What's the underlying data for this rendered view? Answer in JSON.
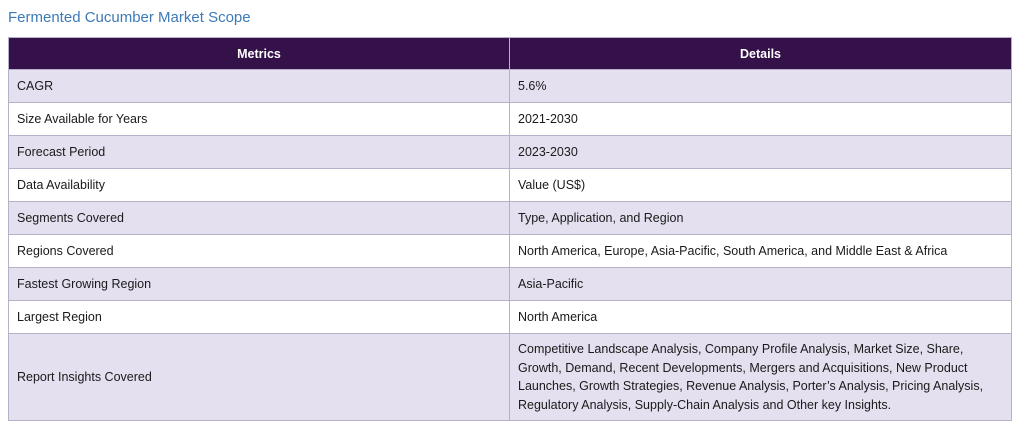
{
  "title": "Fermented Cucumber Market Scope",
  "table": {
    "headers": [
      "Metrics",
      "Details"
    ],
    "rows": [
      {
        "metric": "CAGR",
        "detail": "5.6%"
      },
      {
        "metric": "Size Available for Years",
        "detail": "2021-2030"
      },
      {
        "metric": "Forecast Period",
        "detail": "2023-2030"
      },
      {
        "metric": "Data Availability",
        "detail": "Value (US$)"
      },
      {
        "metric": "Segments Covered",
        "detail": "Type, Application, and Region"
      },
      {
        "metric": "Regions Covered",
        "detail": "North America, Europe, Asia-Pacific, South America, and Middle East & Africa"
      },
      {
        "metric": "Fastest Growing Region",
        "detail": "Asia-Pacific"
      },
      {
        "metric": "Largest Region",
        "detail": "North America"
      },
      {
        "metric": "Report Insights Covered",
        "detail": "Competitive Landscape Analysis, Company Profile Analysis, Market Size, Share, Growth, Demand, Recent Developments, Mergers and Acquisitions, New Product Launches, Growth Strategies, Revenue Analysis, Porter’s Analysis, Pricing Analysis, Regulatory Analysis, Supply-Chain Analysis and Other key Insights."
      }
    ]
  },
  "colors": {
    "title": "#3d7ab8",
    "header_bg": "#35114a",
    "row_alt_bg": "#e4e0ef",
    "border": "#b7b0c9"
  }
}
